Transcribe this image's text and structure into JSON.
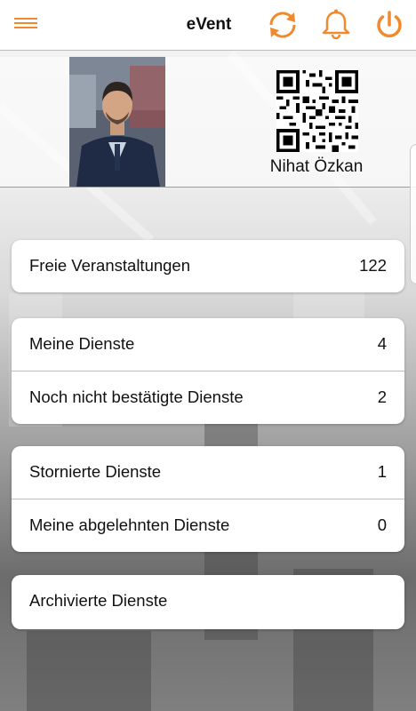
{
  "header": {
    "title": "eVent",
    "accent": "#f08a2c",
    "icons": [
      "menu-icon",
      "sync-icon",
      "bell-icon",
      "power-icon"
    ]
  },
  "profile": {
    "name": "Nihat Özkan"
  },
  "groups": [
    {
      "items": [
        {
          "label": "Freie Veranstaltungen",
          "count": "122"
        }
      ]
    },
    {
      "items": [
        {
          "label": "Meine Dienste",
          "count": "4"
        },
        {
          "label": "Noch nicht bestätigte Dienste",
          "count": "2"
        }
      ]
    },
    {
      "items": [
        {
          "label": "Stornierte Dienste",
          "count": "1"
        },
        {
          "label": "Meine abgelehnten Dienste",
          "count": "0"
        }
      ]
    },
    {
      "items": [
        {
          "label": "Archivierte Dienste",
          "count": ""
        }
      ]
    }
  ]
}
